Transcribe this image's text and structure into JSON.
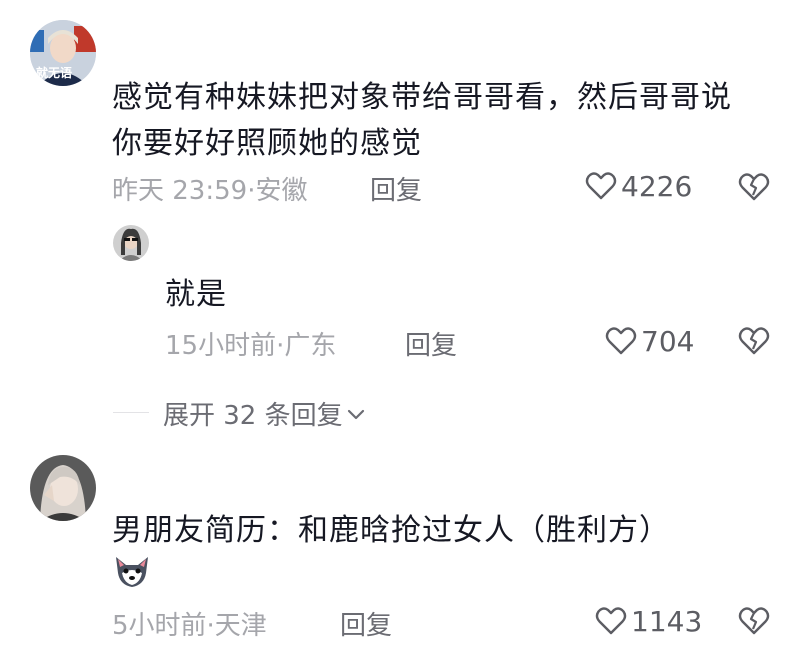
{
  "comments": [
    {
      "avatar_caption": "就无语",
      "text": "感觉有种妹妹把对象带给哥哥看，然后哥哥说你要好好照顾她的感觉",
      "time_location": "昨天 23:59·安徽",
      "reply_label": "回复",
      "likes": "4226",
      "reply": {
        "text": "就是",
        "time_location": "15小时前·广东",
        "reply_label": "回复",
        "likes": "704"
      },
      "expand_label": "展开 32 条回复"
    },
    {
      "text": "男朋友简历：和鹿晗抢过女人（胜利方）",
      "emoji": "wolf-emoji",
      "time_location": "5小时前·天津",
      "reply_label": "回复",
      "likes": "1143"
    }
  ],
  "icons": {
    "like": "heart-icon",
    "dislike": "broken-heart-icon",
    "expand": "chevron-down-icon"
  },
  "colors": {
    "text": "#161823",
    "meta": "#a5a6ab",
    "reply": "#6b6c73"
  }
}
